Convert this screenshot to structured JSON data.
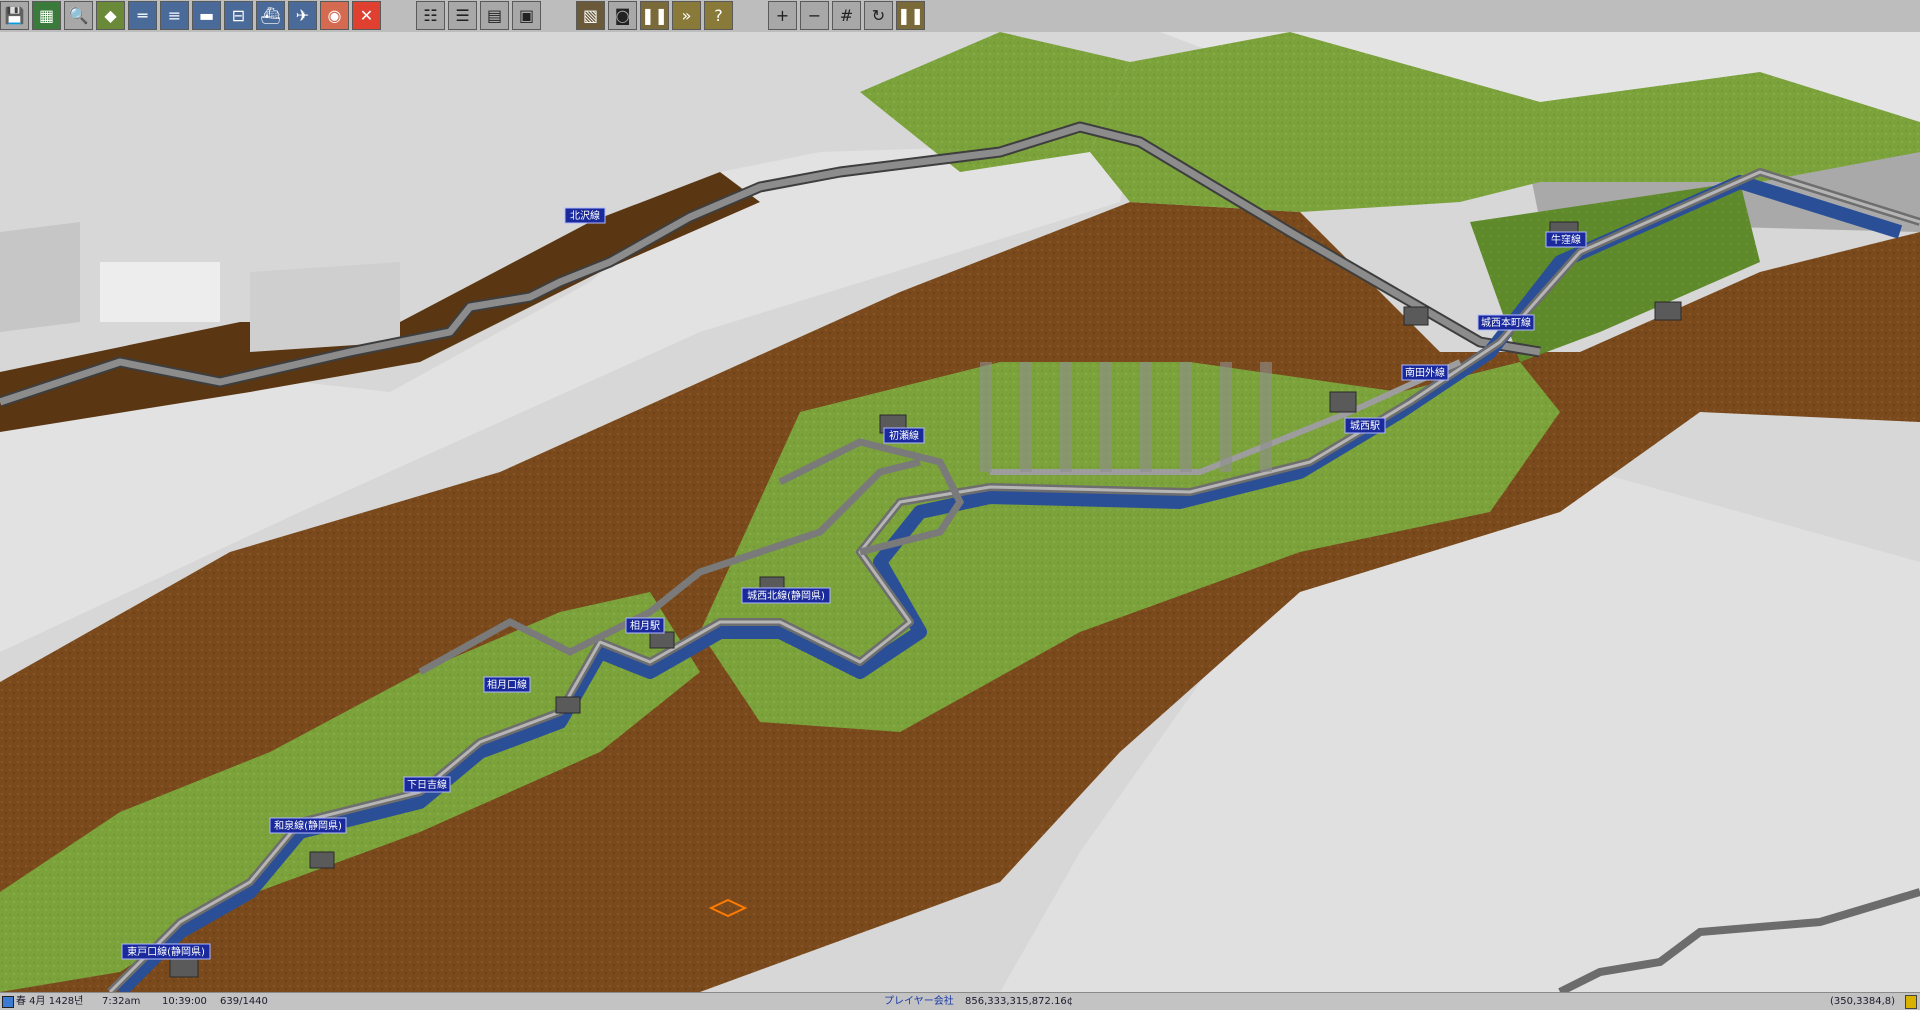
{
  "toolbar": {
    "groups": [
      [
        "save-icon",
        "map-overview-icon",
        "magnify-icon",
        "terrain-icon",
        "rail-icon",
        "monorail-icon",
        "road-icon",
        "tram-icon",
        "ship-icon",
        "air-icon",
        "special-icon",
        "remove-icon"
      ],
      [
        "lines-icon",
        "list-icon",
        "finance-icon",
        "info-icon"
      ],
      [
        "mini-map-icon",
        "screenshot-icon",
        "pause-icon",
        "fast-forward-icon",
        "help-icon"
      ],
      [
        "zoom-in-icon",
        "zoom-out-icon",
        "grid-icon",
        "rotate-icon",
        "pause-indicator-icon"
      ]
    ]
  },
  "stations": [
    {
      "name": "北沢線"
    },
    {
      "name": "牛窪線"
    },
    {
      "name": "城西本町線"
    },
    {
      "name": "南田外線"
    },
    {
      "name": "城西駅"
    },
    {
      "name": "初瀬線"
    },
    {
      "name": "城西北線(静岡県)"
    },
    {
      "name": "相月駅"
    },
    {
      "name": "相月口線"
    },
    {
      "name": "下日吉線"
    },
    {
      "name": "和泉線(静岡県)"
    },
    {
      "name": "東戸口線(静岡県)"
    }
  ],
  "status": {
    "season_icon": "season-icon",
    "date": "春 4月 1428년",
    "time": "7:32am",
    "clock": "10:39:00",
    "counter": "639/1440",
    "company": "プレイヤー会社",
    "money": "856,333,315,872.16¢",
    "coords": "(350,3384,8)"
  },
  "colors": {
    "toolbar_bg": "#bdbdbd",
    "snow": "#d8d8d8",
    "grass": "#7aa23a",
    "dirt": "#7a4a1d",
    "track": "#7d7d7d",
    "water": "#2b4f97",
    "label_bg": "#1a2a9c"
  }
}
